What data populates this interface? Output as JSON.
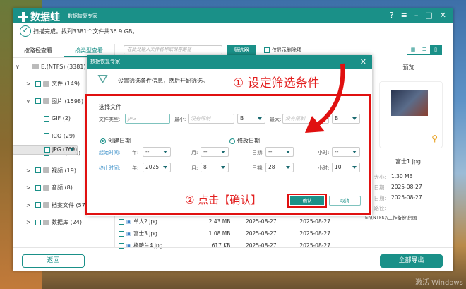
{
  "app": {
    "logo": "数据蛙",
    "subtitle": "数据恢复专家",
    "status": "扫描完成。找到3381个文件共36.9 GB。"
  },
  "window_controls": [
    "?",
    "≡",
    "–",
    "□",
    "✕"
  ],
  "sidebar": {
    "tabs": [
      {
        "label": "按路径查看",
        "active": false
      },
      {
        "label": "按类型查看",
        "active": true
      }
    ],
    "items": [
      {
        "label": "E:(NTFS) (3381)",
        "level": 0,
        "chevron": "∨",
        "icon": "drive-icon"
      },
      {
        "label": "文件 (149)",
        "level": 1,
        "chevron": ">",
        "icon": "document-icon"
      },
      {
        "label": "图片 (1598)",
        "level": 1,
        "chevron": "∨",
        "icon": "image-icon"
      },
      {
        "label": "GIF (2)",
        "level": 2
      },
      {
        "label": "ICO (29)",
        "level": 2
      },
      {
        "label": "JPG (769)",
        "level": 2,
        "selected": true
      },
      {
        "label": "PNG (798)",
        "level": 2
      },
      {
        "label": "视频 (19)",
        "level": 1,
        "chevron": ">",
        "icon": "video-icon"
      },
      {
        "label": "音频 (8)",
        "level": 1,
        "chevron": ">",
        "icon": "audio-icon"
      },
      {
        "label": "档案文件 (571)",
        "level": 1,
        "chevron": ">",
        "icon": "archive-icon"
      },
      {
        "label": "数据库 (24)",
        "level": 1,
        "chevron": ">",
        "icon": "database-icon"
      }
    ]
  },
  "toolbar": {
    "search_placeholder": "在此处输入文件名称或保存路径",
    "filter_label": "筛选器",
    "only_deleted": "仅显示删除项"
  },
  "files": [
    {
      "name": "单人2.jpg",
      "size": "2.43 MB",
      "created": "2025-08-27",
      "modified": "2025-08-27"
    },
    {
      "name": "富士3.jpg",
      "size": "1.08 MB",
      "created": "2025-08-27",
      "modified": "2025-08-27"
    },
    {
      "name": "格陵兰4.jpg",
      "size": "617 KB",
      "created": "2025-08-27",
      "modified": "2025-08-27"
    }
  ],
  "preview": {
    "title": "预览",
    "filename": "富士1.jpg",
    "size_label": "大小:",
    "size": "1.30 MB",
    "created_label": "日期:",
    "created": "2025-08-27",
    "modified_label": "日期:",
    "modified": "2025-08-27",
    "path_label": "路径:",
    "path": "E:\\(NTFS)\\工作备份\\例图"
  },
  "dialog": {
    "title": "数据恢复专家",
    "intro": "设置筛选条件信息，然后开始筛选。",
    "section": "选择文件",
    "file_type_label": "文件类型:",
    "file_type_placeholder": "JPG",
    "min_label": "最小:",
    "min_placeholder": "没有限制",
    "min_unit": "B",
    "max_label": "最大:",
    "max_placeholder": "没有限制",
    "max_unit": "B",
    "radio_created": "创建日期",
    "radio_modified": "修改日期",
    "selected_radio": "created",
    "start_label": "起始时间:",
    "end_label": "终止时间:",
    "year_label": "年:",
    "month_label": "月:",
    "day_label": "日期:",
    "hour_label": "小时:",
    "start": {
      "year": "--",
      "month": "--",
      "day": "--",
      "hour": "--"
    },
    "end": {
      "year": "2025",
      "month": "8",
      "day": "28",
      "hour": "10"
    },
    "ok": "确认",
    "cancel": "取消"
  },
  "annotations": {
    "step1": "① 设定筛选条件",
    "step2": "② 点击【确认】",
    "color": "#e01010"
  },
  "bottom": {
    "back": "返回",
    "export_all": "全部导出"
  },
  "watermark": "激活 Windows",
  "colors": {
    "accent": "#1a9088",
    "annotation": "#e01010"
  }
}
